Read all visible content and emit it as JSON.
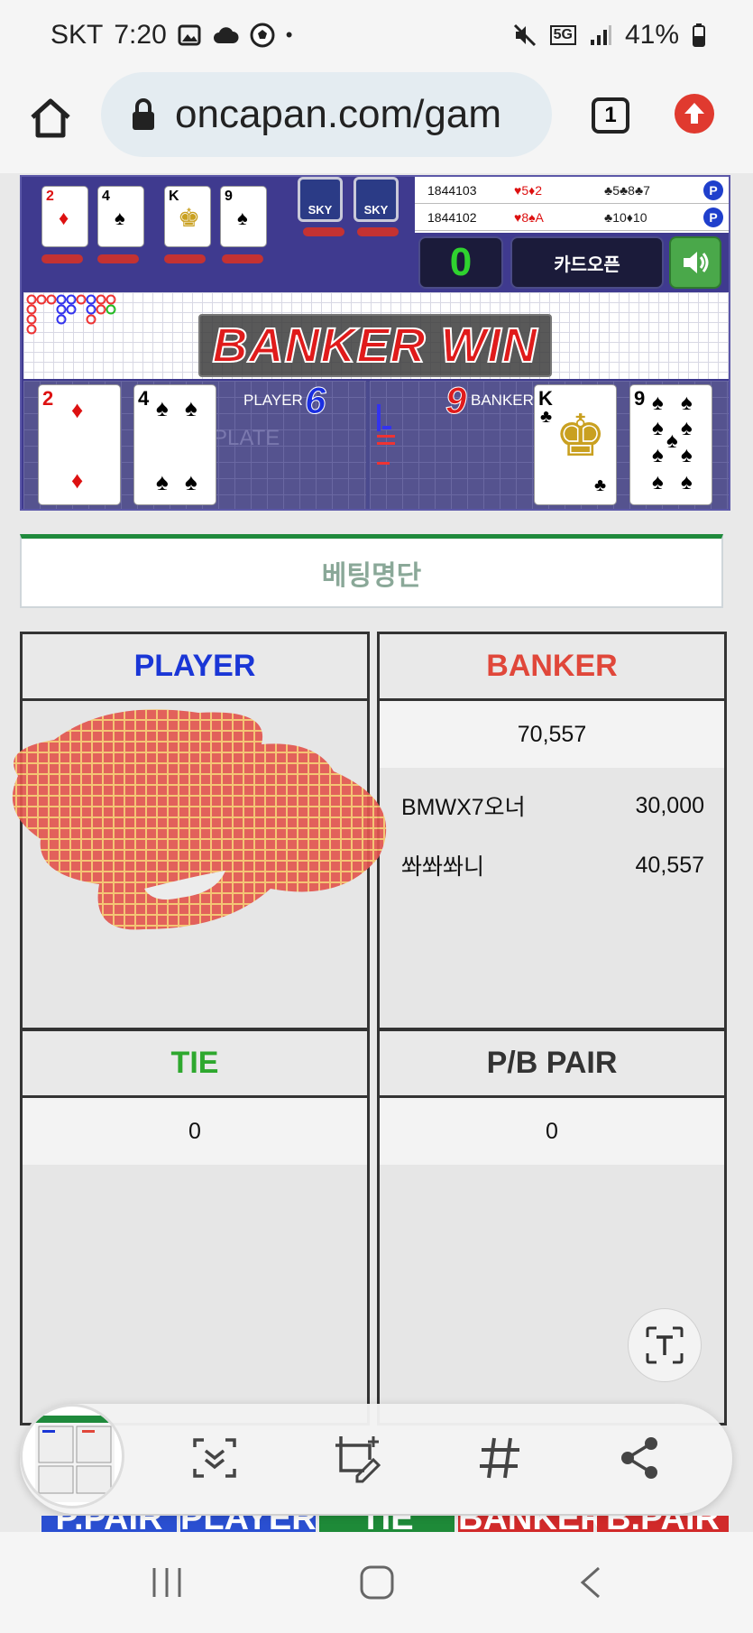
{
  "status_bar": {
    "carrier": "SKT",
    "time": "7:20",
    "network": "5G",
    "battery": "41%"
  },
  "browser": {
    "url": "oncapan.com/gam",
    "tab_count": "1"
  },
  "game": {
    "top_cards": [
      "2",
      "4",
      "K",
      "9"
    ],
    "card_backs": [
      "SKY",
      "SKY"
    ],
    "history": [
      {
        "round": "1844103",
        "player": "♥5♦2",
        "banker": "♣5♣8♣7",
        "result": "P"
      },
      {
        "round": "1844102",
        "player": "♥8♠A",
        "banker": "♣10♦10",
        "result": "P"
      }
    ],
    "counter": "0",
    "card_open_label": "카드오픈",
    "result_banner": "BANKER WIN",
    "player_label": "PLAYER",
    "player_score": "6",
    "banker_label": "BANKER",
    "banker_score": "9",
    "table_watermark": "PLATE",
    "player_cards": [
      {
        "rank": "2",
        "suit": "♦",
        "color": "#d11"
      },
      {
        "rank": "4",
        "suit": "♠",
        "color": "#111"
      }
    ],
    "banker_cards": [
      {
        "rank": "K",
        "suit": "♣",
        "color": "#111"
      },
      {
        "rank": "9",
        "suit": "♠",
        "color": "#111"
      }
    ]
  },
  "bet_list": {
    "title": "베팅명단"
  },
  "panels": {
    "player": {
      "title": "PLAYER",
      "color": "#1a36d6"
    },
    "banker": {
      "title": "BANKER",
      "color": "#e0473a",
      "total": "70,557",
      "entries": [
        {
          "name": "BMWX7오너",
          "amount": "30,000"
        },
        {
          "name": "쏴쏴쏴니",
          "amount": "40,557"
        }
      ]
    },
    "tie": {
      "title": "TIE",
      "color": "#2ea82e",
      "total": "0"
    },
    "pair": {
      "title": "P/B PAIR",
      "color": "#333333",
      "total": "0"
    }
  },
  "bottom_bet_tabs": [
    "P.PAIR",
    "PLAYER",
    "TIE",
    "BANKER",
    "B.PAIR"
  ],
  "toolbar": {
    "icons": [
      "screenshot-thumbnail",
      "scroll-capture-icon",
      "edit-crop-icon",
      "hashtag-icon",
      "share-icon"
    ]
  },
  "colors": {
    "accent_green": "#1f8a3c",
    "banker_red": "#e0473a",
    "player_blue": "#1a36d6"
  }
}
